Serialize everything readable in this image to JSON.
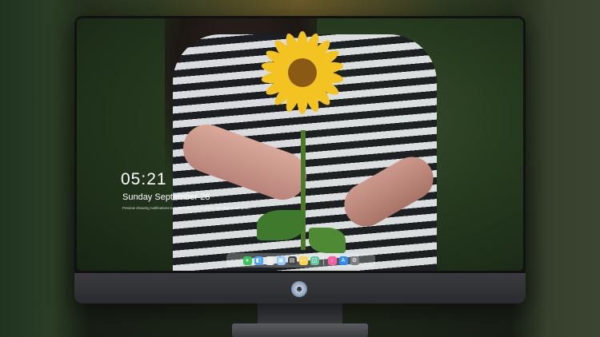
{
  "lock_screen": {
    "time": "05:21",
    "date": "Sunday September  28",
    "note": "Preview showing notifications to watch your live art library, get started with quiet."
  },
  "dock": {
    "apps": [
      {
        "name": "messages-icon",
        "glyph": "●",
        "color": "#34c759"
      },
      {
        "name": "finder-icon",
        "glyph": "◧",
        "color": "#4aa3ff"
      },
      {
        "name": "safari-icon",
        "glyph": "◎",
        "color": "#e8e8e8"
      },
      {
        "name": "preview-icon",
        "glyph": "▣",
        "color": "#8ec9ff"
      },
      {
        "name": "clapper-icon",
        "glyph": "▤",
        "color": "#444"
      },
      {
        "name": "notes-icon",
        "glyph": "▭",
        "color": "#ffd34d"
      },
      {
        "name": "photos-icon",
        "glyph": "◫",
        "color": "#5cc8a0"
      },
      {
        "name": "music-icon",
        "glyph": "♪",
        "color": "#ff5fa2"
      },
      {
        "name": "app-store-icon",
        "glyph": "A",
        "color": "#2f8cff"
      },
      {
        "name": "settings-icon",
        "glyph": "⚙",
        "color": "#7d7d82"
      }
    ]
  },
  "colors": {
    "petal": "#f2c321",
    "center": "#8a5a14",
    "bezel": "#111111",
    "chin": "#2f3034"
  }
}
